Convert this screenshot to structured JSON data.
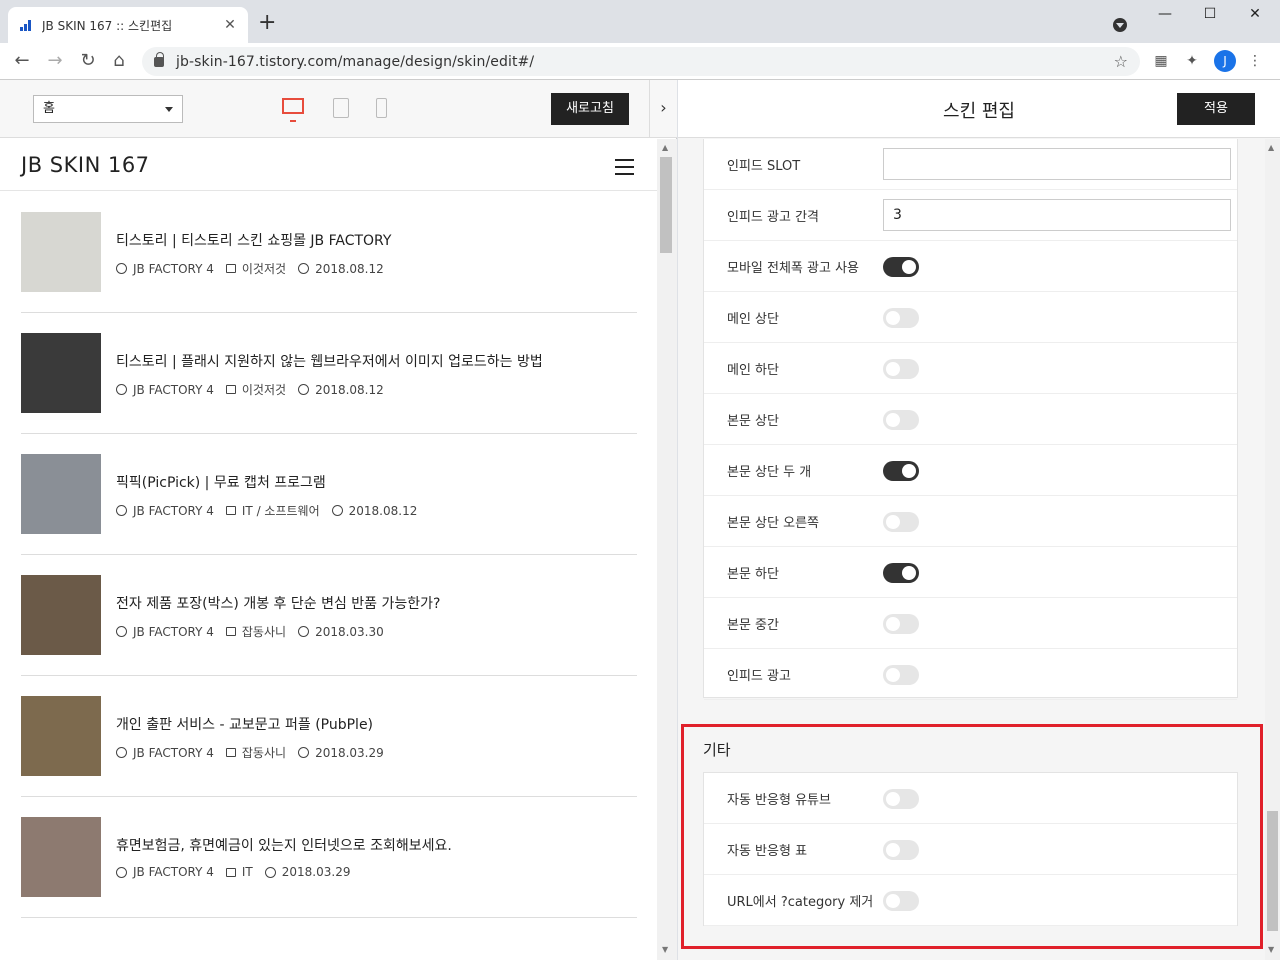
{
  "browser": {
    "tab_title": "JB SKIN 167 :: 스킨편집",
    "tab_close": "✕",
    "new_tab": "+",
    "url": "jb-skin-167.tistory.com/manage/design/skin/edit#/",
    "profile_initial": "J",
    "win_minimize": "—",
    "win_maximize": "☐",
    "win_close": "✕",
    "back": "←",
    "forward": "→",
    "reload": "↻",
    "home": "⌂",
    "star": "☆"
  },
  "preview_toolbar": {
    "page_select_value": "홈",
    "refresh_label": "새로고침",
    "collapse_arrow": "›"
  },
  "blog": {
    "title": "JB SKIN 167",
    "posts": [
      {
        "title": "티스토리 | 티스토리 스킨 쇼핑몰 JB FACTORY",
        "author": "JB FACTORY 4",
        "category": "이것저것",
        "date": "2018.08.12",
        "thumb_color": "#d7d7d2"
      },
      {
        "title": "티스토리 | 플래시 지원하지 않는 웹브라우저에서 이미지 업로드하는 방법",
        "author": "JB FACTORY 4",
        "category": "이것저것",
        "date": "2018.08.12",
        "thumb_color": "#3a3a3a"
      },
      {
        "title": "픽픽(PicPick) | 무료 캡처 프로그램",
        "author": "JB FACTORY 4",
        "category": "IT / 소프트웨어",
        "date": "2018.08.12",
        "thumb_color": "#8a8f96"
      },
      {
        "title": "전자 제품 포장(박스) 개봉 후 단순 변심 반품 가능한가?",
        "author": "JB FACTORY 4",
        "category": "잡동사니",
        "date": "2018.03.30",
        "thumb_color": "#6b5a48"
      },
      {
        "title": "개인 출판 서비스 - 교보문고 퍼플 (PubPle)",
        "author": "JB FACTORY 4",
        "category": "잡동사니",
        "date": "2018.03.29",
        "thumb_color": "#7d6a4e"
      },
      {
        "title": "휴면보험금, 휴면예금이 있는지 인터넷으로 조회해보세요.",
        "author": "JB FACTORY 4",
        "category": "IT",
        "date": "2018.03.29",
        "thumb_color": "#8d7a70"
      }
    ]
  },
  "editor": {
    "title": "스킨 편집",
    "apply_label": "적용",
    "ad_rows": [
      {
        "label": "인피드 SLOT",
        "type": "input",
        "value": ""
      },
      {
        "label": "인피드 광고 간격",
        "type": "input",
        "value": "3"
      },
      {
        "label": "모바일 전체폭 광고 사용",
        "type": "toggle",
        "on": true
      },
      {
        "label": "메인 상단",
        "type": "toggle",
        "on": false
      },
      {
        "label": "메인 하단",
        "type": "toggle",
        "on": false
      },
      {
        "label": "본문 상단",
        "type": "toggle",
        "on": false
      },
      {
        "label": "본문 상단 두 개",
        "type": "toggle",
        "on": true
      },
      {
        "label": "본문 상단 오른쪽",
        "type": "toggle",
        "on": false
      },
      {
        "label": "본문 하단",
        "type": "toggle",
        "on": true
      },
      {
        "label": "본문 중간",
        "type": "toggle",
        "on": false
      },
      {
        "label": "인피드 광고",
        "type": "toggle",
        "on": false
      }
    ],
    "etc_section": {
      "title": "기타",
      "rows": [
        {
          "label": "자동 반응형 유튜브",
          "on": false
        },
        {
          "label": "자동 반응형 표",
          "on": false
        },
        {
          "label": "URL에서 ?category 제거",
          "on": false
        }
      ]
    },
    "highlight_color": "#e0202a"
  }
}
